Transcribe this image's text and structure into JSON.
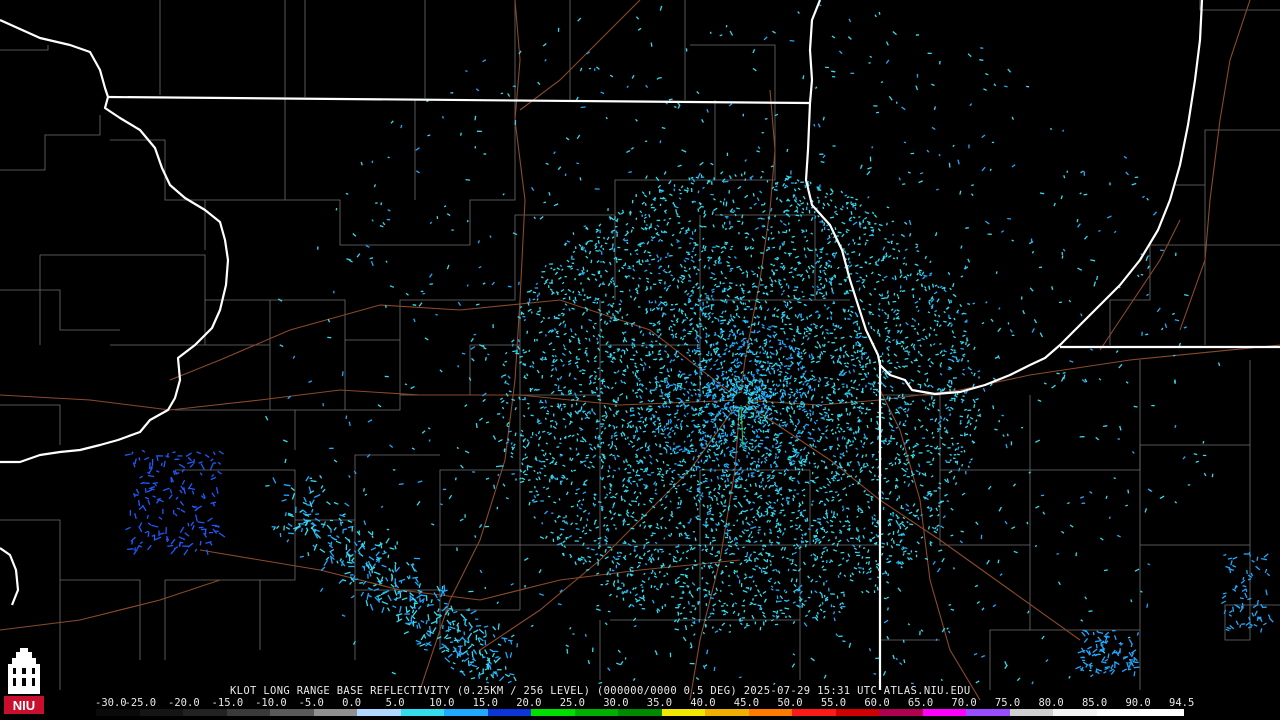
{
  "product": {
    "caption": "KLOT LONG RANGE BASE REFLECTIVITY (0.25KM / 256 LEVEL) (000000/0000 0.5 DEG) 2025-07-29 15:31 UTC  ATLAS.NIU.EDU"
  },
  "scale": {
    "labels": [
      "-30.0",
      "-25.0",
      "-20.0",
      "-15.0",
      "-10.0",
      "-5.0",
      "0.0",
      "5.0",
      "10.0",
      "15.0",
      "20.0",
      "25.0",
      "30.0",
      "35.0",
      "40.0",
      "45.0",
      "50.0",
      "55.0",
      "60.0",
      "65.0",
      "70.0",
      "75.0",
      "80.0",
      "85.0",
      "90.0",
      "94.5"
    ],
    "colors": [
      "#0a0a0a",
      "#151515",
      "#222222",
      "#3a3a3a",
      "#5a5a5a",
      "#909090",
      "#b0d8ff",
      "#33ddee",
      "#21a8ff",
      "#0b35d8",
      "#00e000",
      "#00b000",
      "#008a00",
      "#f0e800",
      "#f0b000",
      "#ff7a00",
      "#ff1a1a",
      "#d00000",
      "#b00050",
      "#ff00ff",
      "#9a4dff",
      "#cfcfcf",
      "#f4f4f4",
      "#ffffff",
      "#ffffff"
    ]
  },
  "colors": {
    "background": "#000000",
    "state_border": "#ffffff",
    "county_border": "#8a8a8a",
    "highway": "#8b4a2b",
    "echo_light": "#33ddee",
    "echo_medium": "#21a8ff",
    "echo_blue": "#1d5bff",
    "radar_site": "#000000"
  },
  "logo": {
    "text": "NIU",
    "bg": "#c8102e"
  },
  "icons": {
    "logo": "niu-tower-logo"
  }
}
